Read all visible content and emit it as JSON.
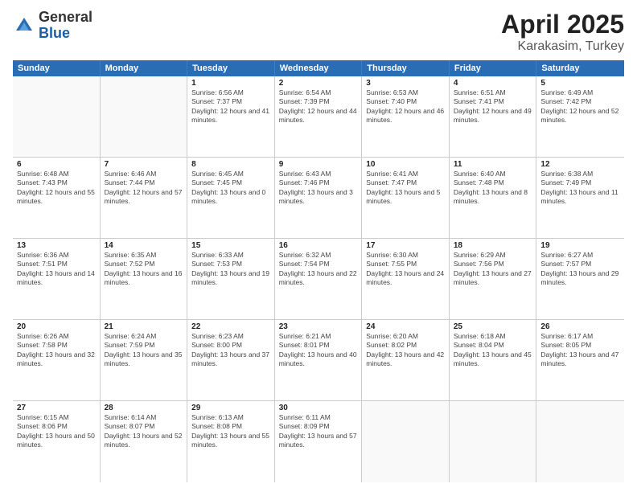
{
  "logo": {
    "general": "General",
    "blue": "Blue"
  },
  "title": "April 2025",
  "location": "Karakasim, Turkey",
  "days_of_week": [
    "Sunday",
    "Monday",
    "Tuesday",
    "Wednesday",
    "Thursday",
    "Friday",
    "Saturday"
  ],
  "weeks": [
    [
      {
        "day": "",
        "sunrise": "",
        "sunset": "",
        "daylight": ""
      },
      {
        "day": "",
        "sunrise": "",
        "sunset": "",
        "daylight": ""
      },
      {
        "day": "1",
        "sunrise": "Sunrise: 6:56 AM",
        "sunset": "Sunset: 7:37 PM",
        "daylight": "Daylight: 12 hours and 41 minutes."
      },
      {
        "day": "2",
        "sunrise": "Sunrise: 6:54 AM",
        "sunset": "Sunset: 7:39 PM",
        "daylight": "Daylight: 12 hours and 44 minutes."
      },
      {
        "day": "3",
        "sunrise": "Sunrise: 6:53 AM",
        "sunset": "Sunset: 7:40 PM",
        "daylight": "Daylight: 12 hours and 46 minutes."
      },
      {
        "day": "4",
        "sunrise": "Sunrise: 6:51 AM",
        "sunset": "Sunset: 7:41 PM",
        "daylight": "Daylight: 12 hours and 49 minutes."
      },
      {
        "day": "5",
        "sunrise": "Sunrise: 6:49 AM",
        "sunset": "Sunset: 7:42 PM",
        "daylight": "Daylight: 12 hours and 52 minutes."
      }
    ],
    [
      {
        "day": "6",
        "sunrise": "Sunrise: 6:48 AM",
        "sunset": "Sunset: 7:43 PM",
        "daylight": "Daylight: 12 hours and 55 minutes."
      },
      {
        "day": "7",
        "sunrise": "Sunrise: 6:46 AM",
        "sunset": "Sunset: 7:44 PM",
        "daylight": "Daylight: 12 hours and 57 minutes."
      },
      {
        "day": "8",
        "sunrise": "Sunrise: 6:45 AM",
        "sunset": "Sunset: 7:45 PM",
        "daylight": "Daylight: 13 hours and 0 minutes."
      },
      {
        "day": "9",
        "sunrise": "Sunrise: 6:43 AM",
        "sunset": "Sunset: 7:46 PM",
        "daylight": "Daylight: 13 hours and 3 minutes."
      },
      {
        "day": "10",
        "sunrise": "Sunrise: 6:41 AM",
        "sunset": "Sunset: 7:47 PM",
        "daylight": "Daylight: 13 hours and 5 minutes."
      },
      {
        "day": "11",
        "sunrise": "Sunrise: 6:40 AM",
        "sunset": "Sunset: 7:48 PM",
        "daylight": "Daylight: 13 hours and 8 minutes."
      },
      {
        "day": "12",
        "sunrise": "Sunrise: 6:38 AM",
        "sunset": "Sunset: 7:49 PM",
        "daylight": "Daylight: 13 hours and 11 minutes."
      }
    ],
    [
      {
        "day": "13",
        "sunrise": "Sunrise: 6:36 AM",
        "sunset": "Sunset: 7:51 PM",
        "daylight": "Daylight: 13 hours and 14 minutes."
      },
      {
        "day": "14",
        "sunrise": "Sunrise: 6:35 AM",
        "sunset": "Sunset: 7:52 PM",
        "daylight": "Daylight: 13 hours and 16 minutes."
      },
      {
        "day": "15",
        "sunrise": "Sunrise: 6:33 AM",
        "sunset": "Sunset: 7:53 PM",
        "daylight": "Daylight: 13 hours and 19 minutes."
      },
      {
        "day": "16",
        "sunrise": "Sunrise: 6:32 AM",
        "sunset": "Sunset: 7:54 PM",
        "daylight": "Daylight: 13 hours and 22 minutes."
      },
      {
        "day": "17",
        "sunrise": "Sunrise: 6:30 AM",
        "sunset": "Sunset: 7:55 PM",
        "daylight": "Daylight: 13 hours and 24 minutes."
      },
      {
        "day": "18",
        "sunrise": "Sunrise: 6:29 AM",
        "sunset": "Sunset: 7:56 PM",
        "daylight": "Daylight: 13 hours and 27 minutes."
      },
      {
        "day": "19",
        "sunrise": "Sunrise: 6:27 AM",
        "sunset": "Sunset: 7:57 PM",
        "daylight": "Daylight: 13 hours and 29 minutes."
      }
    ],
    [
      {
        "day": "20",
        "sunrise": "Sunrise: 6:26 AM",
        "sunset": "Sunset: 7:58 PM",
        "daylight": "Daylight: 13 hours and 32 minutes."
      },
      {
        "day": "21",
        "sunrise": "Sunrise: 6:24 AM",
        "sunset": "Sunset: 7:59 PM",
        "daylight": "Daylight: 13 hours and 35 minutes."
      },
      {
        "day": "22",
        "sunrise": "Sunrise: 6:23 AM",
        "sunset": "Sunset: 8:00 PM",
        "daylight": "Daylight: 13 hours and 37 minutes."
      },
      {
        "day": "23",
        "sunrise": "Sunrise: 6:21 AM",
        "sunset": "Sunset: 8:01 PM",
        "daylight": "Daylight: 13 hours and 40 minutes."
      },
      {
        "day": "24",
        "sunrise": "Sunrise: 6:20 AM",
        "sunset": "Sunset: 8:02 PM",
        "daylight": "Daylight: 13 hours and 42 minutes."
      },
      {
        "day": "25",
        "sunrise": "Sunrise: 6:18 AM",
        "sunset": "Sunset: 8:04 PM",
        "daylight": "Daylight: 13 hours and 45 minutes."
      },
      {
        "day": "26",
        "sunrise": "Sunrise: 6:17 AM",
        "sunset": "Sunset: 8:05 PM",
        "daylight": "Daylight: 13 hours and 47 minutes."
      }
    ],
    [
      {
        "day": "27",
        "sunrise": "Sunrise: 6:15 AM",
        "sunset": "Sunset: 8:06 PM",
        "daylight": "Daylight: 13 hours and 50 minutes."
      },
      {
        "day": "28",
        "sunrise": "Sunrise: 6:14 AM",
        "sunset": "Sunset: 8:07 PM",
        "daylight": "Daylight: 13 hours and 52 minutes."
      },
      {
        "day": "29",
        "sunrise": "Sunrise: 6:13 AM",
        "sunset": "Sunset: 8:08 PM",
        "daylight": "Daylight: 13 hours and 55 minutes."
      },
      {
        "day": "30",
        "sunrise": "Sunrise: 6:11 AM",
        "sunset": "Sunset: 8:09 PM",
        "daylight": "Daylight: 13 hours and 57 minutes."
      },
      {
        "day": "",
        "sunrise": "",
        "sunset": "",
        "daylight": ""
      },
      {
        "day": "",
        "sunrise": "",
        "sunset": "",
        "daylight": ""
      },
      {
        "day": "",
        "sunrise": "",
        "sunset": "",
        "daylight": ""
      }
    ]
  ]
}
